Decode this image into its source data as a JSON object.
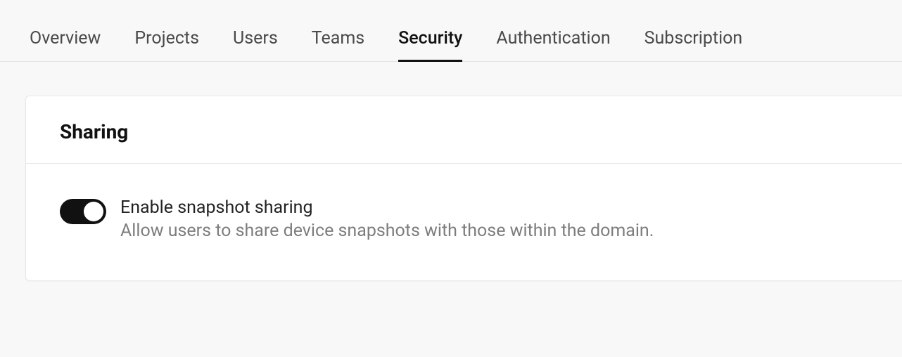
{
  "tabs": {
    "overview": "Overview",
    "projects": "Projects",
    "users": "Users",
    "teams": "Teams",
    "security": "Security",
    "authentication": "Authentication",
    "subscription": "Subscription"
  },
  "card": {
    "title": "Sharing",
    "setting": {
      "title": "Enable snapshot sharing",
      "description": "Allow users to share device snapshots with those within the domain."
    }
  }
}
